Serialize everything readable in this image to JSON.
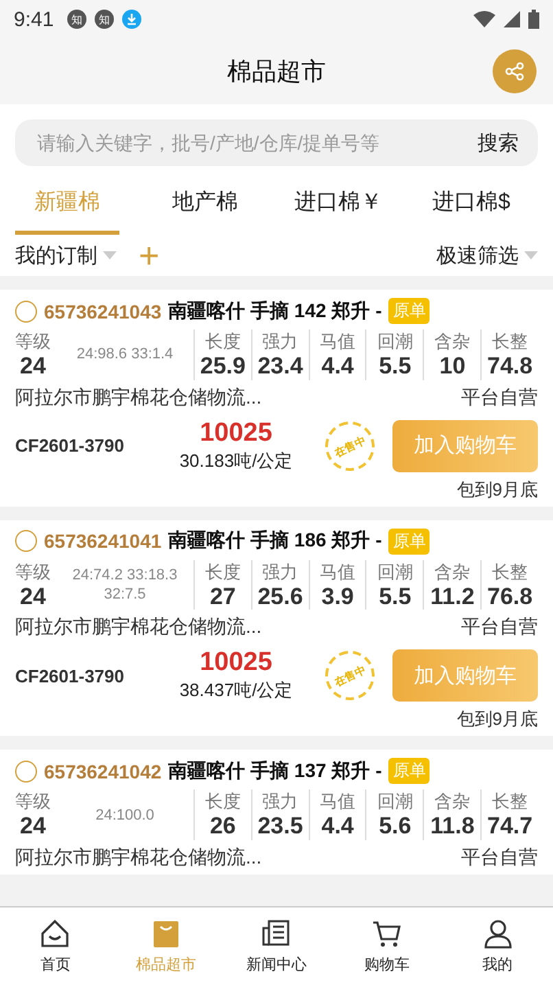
{
  "status_bar": {
    "time": "9:41",
    "notifications": [
      {
        "kind": "app",
        "glyph": "知"
      },
      {
        "kind": "app",
        "glyph": "知"
      },
      {
        "kind": "download"
      }
    ]
  },
  "header": {
    "title": "棉品超市"
  },
  "search": {
    "placeholder": "请输入关键字，批号/产地/仓库/提单号等",
    "button": "搜索"
  },
  "tabs": [
    {
      "label": "新疆棉",
      "selected": true
    },
    {
      "label": "地产棉",
      "selected": false
    },
    {
      "label": "进口棉￥",
      "selected": false
    },
    {
      "label": "进口棉$",
      "selected": false
    }
  ],
  "filters": {
    "custom": "我的订制",
    "add": "+",
    "quick": "极速筛选"
  },
  "cards": [
    {
      "selected": false,
      "id": "65736241043",
      "title": "南疆喀什 手摘 142 郑升 -",
      "badge": "原单",
      "grade_label": "等级",
      "grade": "24",
      "grade_note": "24:98.6 33:1.4",
      "metrics": [
        {
          "label": "长度",
          "value": "25.9"
        },
        {
          "label": "强力",
          "value": "23.4"
        },
        {
          "label": "马值",
          "value": "4.4"
        },
        {
          "label": "回潮",
          "value": "5.5"
        },
        {
          "label": "含杂",
          "value": "10"
        },
        {
          "label": "长整",
          "value": "74.8"
        }
      ],
      "warehouse": "阿拉尔市鹏宇棉花仓储物流...",
      "seller": "平台自营",
      "contract": "CF2601-3790",
      "price": "10025",
      "weight": "30.183吨/公定",
      "stamp": "在售中",
      "button": "加入购物车",
      "note": "包到9月底"
    },
    {
      "selected": false,
      "id": "65736241041",
      "title": "南疆喀什 手摘 186 郑升 -",
      "badge": "原单",
      "grade_label": "等级",
      "grade": "24",
      "grade_note": "24:74.2 33:18.3 32:7.5",
      "metrics": [
        {
          "label": "长度",
          "value": "27"
        },
        {
          "label": "强力",
          "value": "25.6"
        },
        {
          "label": "马值",
          "value": "3.9"
        },
        {
          "label": "回潮",
          "value": "5.5"
        },
        {
          "label": "含杂",
          "value": "11.2"
        },
        {
          "label": "长整",
          "value": "76.8"
        }
      ],
      "warehouse": "阿拉尔市鹏宇棉花仓储物流...",
      "seller": "平台自营",
      "contract": "CF2601-3790",
      "price": "10025",
      "weight": "38.437吨/公定",
      "stamp": "在售中",
      "button": "加入购物车",
      "note": "包到9月底"
    },
    {
      "selected": false,
      "id": "65736241042",
      "title": "南疆喀什 手摘 137 郑升 -",
      "badge": "原单",
      "grade_label": "等级",
      "grade": "24",
      "grade_note": "24:100.0",
      "metrics": [
        {
          "label": "长度",
          "value": "26"
        },
        {
          "label": "强力",
          "value": "23.5"
        },
        {
          "label": "马值",
          "value": "4.4"
        },
        {
          "label": "回潮",
          "value": "5.6"
        },
        {
          "label": "含杂",
          "value": "11.8"
        },
        {
          "label": "长整",
          "value": "74.7"
        }
      ],
      "warehouse": "阿拉尔市鹏宇棉花仓储物流...",
      "seller": "平台自营"
    }
  ],
  "nav": [
    {
      "label": "首页",
      "kind": "home",
      "selected": false
    },
    {
      "label": "棉品超市",
      "kind": "market",
      "selected": true
    },
    {
      "label": "新闻中心",
      "kind": "news",
      "selected": false
    },
    {
      "label": "购物车",
      "kind": "cart",
      "selected": false
    },
    {
      "label": "我的",
      "kind": "profile",
      "selected": false
    }
  ]
}
